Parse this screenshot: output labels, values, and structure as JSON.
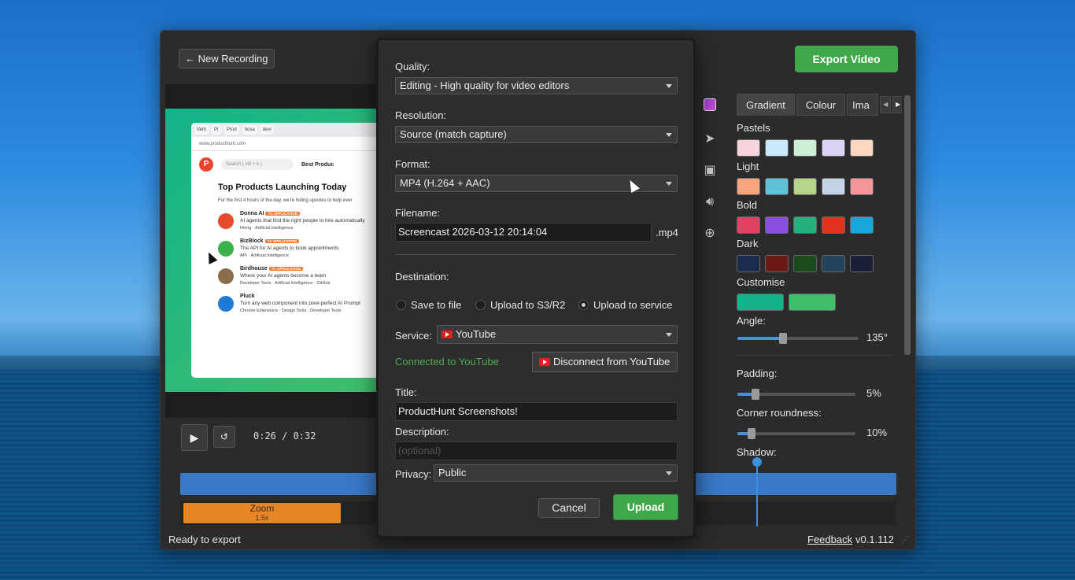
{
  "app": {
    "new_recording": "← New Recording",
    "export_video": "Export Video",
    "status": "Ready to export",
    "feedback": "Feedback",
    "version": "v0.1.112"
  },
  "preview": {
    "browser_tabs": [
      "Verti",
      "Pr",
      "Prod",
      "hosa",
      "devi"
    ],
    "url": "www.producthunt.com",
    "search_placeholder": "Search ( ctrl + k )",
    "best": "Best Produc",
    "heading": "Top Products Launching Today",
    "subheading": "For the first 4 hours of the day, we're hiding upvotes to help ever",
    "badge": "YC APPLICATION",
    "items": [
      {
        "name": "Donna AI",
        "desc": "AI agents that find the right people to hire automatically",
        "tags": "Hiring · Artificial Intelligence",
        "color": "#e74b2e"
      },
      {
        "name": "BizBlock",
        "desc": "The API for AI agents to book appointments",
        "tags": "API · Artificial Intelligence",
        "color": "#3bb34a"
      },
      {
        "name": "Birdhouse",
        "desc": "Where your AI agents become a team",
        "tags": "Developer Tools · Artificial Intelligence · GitHub",
        "color": "#8a6d4b"
      },
      {
        "name": "Pluck",
        "desc": "Turn any web component into pixel-perfect AI Prompt",
        "tags": "Chrome Extensions · Design Tools · Developer Tools",
        "color": "#1f7ad6"
      }
    ]
  },
  "player": {
    "play": "▶",
    "loop": "↺",
    "timecode": "0:26  /  0:32"
  },
  "background_panel": {
    "tabs": [
      "Gradient",
      "Colour",
      "Ima"
    ],
    "sections": {
      "pastels": "Pastels",
      "light": "Light",
      "bold": "Bold",
      "dark": "Dark",
      "customise": "Customise"
    },
    "swatches": {
      "pastels": [
        "#fbd3dc",
        "#c7e9fb",
        "#cdeed6",
        "#ddd3f7",
        "#fdd8c0"
      ],
      "light": [
        "#f7a57f",
        "#5ec3d6",
        "#b5d68a",
        "#c2d4e6",
        "#f6959a"
      ],
      "bold": [
        "#e04361",
        "#8b4fe0",
        "#25b07e",
        "#e3321e",
        "#1aa6db"
      ],
      "dark": [
        "#1a2b4f",
        "#6b1b17",
        "#1b4a1c",
        "#22445e",
        "#1b1f3a"
      ],
      "customise": [
        "#12b38a",
        "#3fbf6a"
      ]
    },
    "angle_label": "Angle:",
    "angle_value": "135°",
    "angle_fraction": 0.375,
    "padding_label": "Padding:",
    "padding_value": "5%",
    "padding_fraction": 0.15,
    "corner_label": "Corner roundness:",
    "corner_value": "10%",
    "corner_fraction": 0.12,
    "shadow_label": "Shadow:"
  },
  "timeline": {
    "zoom_label": "Zoom",
    "zoom_factor": "1.5x"
  },
  "dialog": {
    "quality_label": "Quality:",
    "quality_value": "Editing - High quality for video editors",
    "resolution_label": "Resolution:",
    "resolution_value": "Source (match capture)",
    "format_label": "Format:",
    "format_value": "MP4 (H.264 + AAC)",
    "filename_label": "Filename:",
    "filename_value": "Screencast 2026-03-12 20:14:04",
    "filename_suffix": ".mp4",
    "destination_label": "Destination:",
    "destinations": [
      "Save to file",
      "Upload to S3/R2",
      "Upload to service"
    ],
    "destination_selected": 2,
    "service_label": "Service:",
    "service_value": "YouTube",
    "connected": "Connected to YouTube",
    "disconnect": "Disconnect from YouTube",
    "title_label": "Title:",
    "title_value": "ProductHunt Screenshots!",
    "description_label": "Description:",
    "description_placeholder": "(optional)",
    "privacy_label": "Privacy:",
    "privacy_value": "Public",
    "cancel": "Cancel",
    "upload": "Upload"
  }
}
